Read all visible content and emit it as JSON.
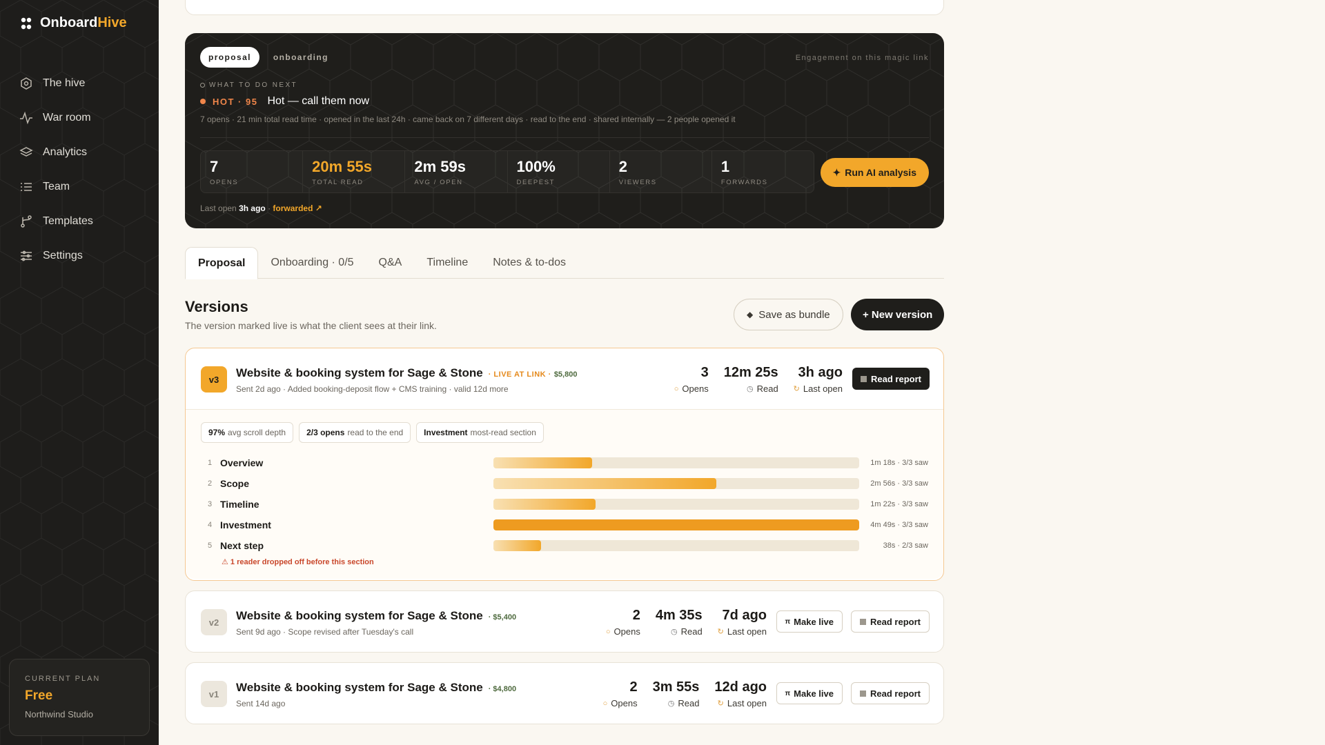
{
  "brand": {
    "name_part1": "Onboard",
    "name_part2": "Hive"
  },
  "sidebar": {
    "items": [
      {
        "label": "The hive",
        "icon": "hive-icon"
      },
      {
        "label": "War room",
        "icon": "pulse-icon"
      },
      {
        "label": "Analytics",
        "icon": "layers-icon"
      },
      {
        "label": "Team",
        "icon": "list-icon"
      },
      {
        "label": "Templates",
        "icon": "branch-icon"
      },
      {
        "label": "Settings",
        "icon": "sliders-icon"
      }
    ],
    "plan": {
      "caption": "CURRENT PLAN",
      "name": "Free",
      "org": "Northwind Studio"
    }
  },
  "engagement": {
    "pills": [
      "proposal",
      "onboarding"
    ],
    "header_note": "Engagement on this magic link",
    "what_next_label": "WHAT TO DO NEXT",
    "hot_tag": "HOT · 95",
    "hot_title": "Hot — call them now",
    "hot_detail": "7 opens · 21 min total read time · opened in the last 24h · came back on 7 different days · read to the end · shared internally — 2 people opened it",
    "stats": [
      {
        "value": "7",
        "label": "OPENS"
      },
      {
        "value": "20m 55s",
        "label": "TOTAL READ"
      },
      {
        "value": "2m 59s",
        "label": "AVG / OPEN"
      },
      {
        "value": "100%",
        "label": "DEEPEST"
      },
      {
        "value": "2",
        "label": "VIEWERS"
      },
      {
        "value": "1",
        "label": "FORWARDS"
      }
    ],
    "ai_button": "Run AI analysis",
    "last_open_prefix": "Last open",
    "last_open_value": "3h ago",
    "last_open_sep": "·",
    "forwarded": "forwarded ↗"
  },
  "tabs": [
    "Proposal",
    "Onboarding · 0/5",
    "Q&A",
    "Timeline",
    "Notes & to-dos"
  ],
  "versions": {
    "title": "Versions",
    "subtitle": "The version marked live is what the client sees at their link.",
    "save_bundle": "Save as bundle",
    "new_version": "+ New version",
    "items": [
      {
        "badge": "v3",
        "title": "Website & booking system for Sage & Stone",
        "live_tag": "· LIVE AT LINK ·",
        "price": "$5,800",
        "sub": "Sent 2d ago · Added booking-deposit flow + CMS training · valid 12d more",
        "opens": "3",
        "opens_label": "Opens",
        "read": "12m 25s",
        "read_label": "Read",
        "last": "3h ago",
        "last_label": "Last open",
        "report_btn": "Read report"
      },
      {
        "badge": "v2",
        "title": "Website & booking system for Sage & Stone",
        "price": "· $5,400",
        "sub": "Sent 9d ago · Scope revised after Tuesday's call",
        "opens": "2",
        "opens_label": "Opens",
        "read": "4m 35s",
        "read_label": "Read",
        "last": "7d ago",
        "last_label": "Last open",
        "make_live": "Make live",
        "report_btn": "Read report"
      },
      {
        "badge": "v1",
        "title": "Website & booking system for Sage & Stone",
        "price": "· $4,800",
        "sub": "Sent 14d ago",
        "opens": "2",
        "opens_label": "Opens",
        "read": "3m 55s",
        "read_label": "Read",
        "last": "12d ago",
        "last_label": "Last open",
        "make_live": "Make live",
        "report_btn": "Read report"
      }
    ],
    "chips": [
      {
        "bold": "97%",
        "rest": "avg scroll depth"
      },
      {
        "bold": "2/3 opens",
        "rest": "read to the end"
      },
      {
        "bold": "Investment",
        "rest": "most-read section"
      }
    ],
    "sections": [
      {
        "n": "1",
        "name": "Overview",
        "time": "1m 18s · 3/3 saw",
        "fill": 0.27
      },
      {
        "n": "2",
        "name": "Scope",
        "time": "2m 56s · 3/3 saw",
        "fill": 0.61
      },
      {
        "n": "3",
        "name": "Timeline",
        "time": "1m 22s · 3/3 saw",
        "fill": 0.28
      },
      {
        "n": "4",
        "name": "Investment",
        "time": "4m 49s · 3/3 saw",
        "fill": 1.0
      },
      {
        "n": "5",
        "name": "Next step",
        "time": "38s · 2/3 saw",
        "fill": 0.13
      }
    ],
    "drop_warning": "⚠ 1 reader dropped off before this section"
  }
}
